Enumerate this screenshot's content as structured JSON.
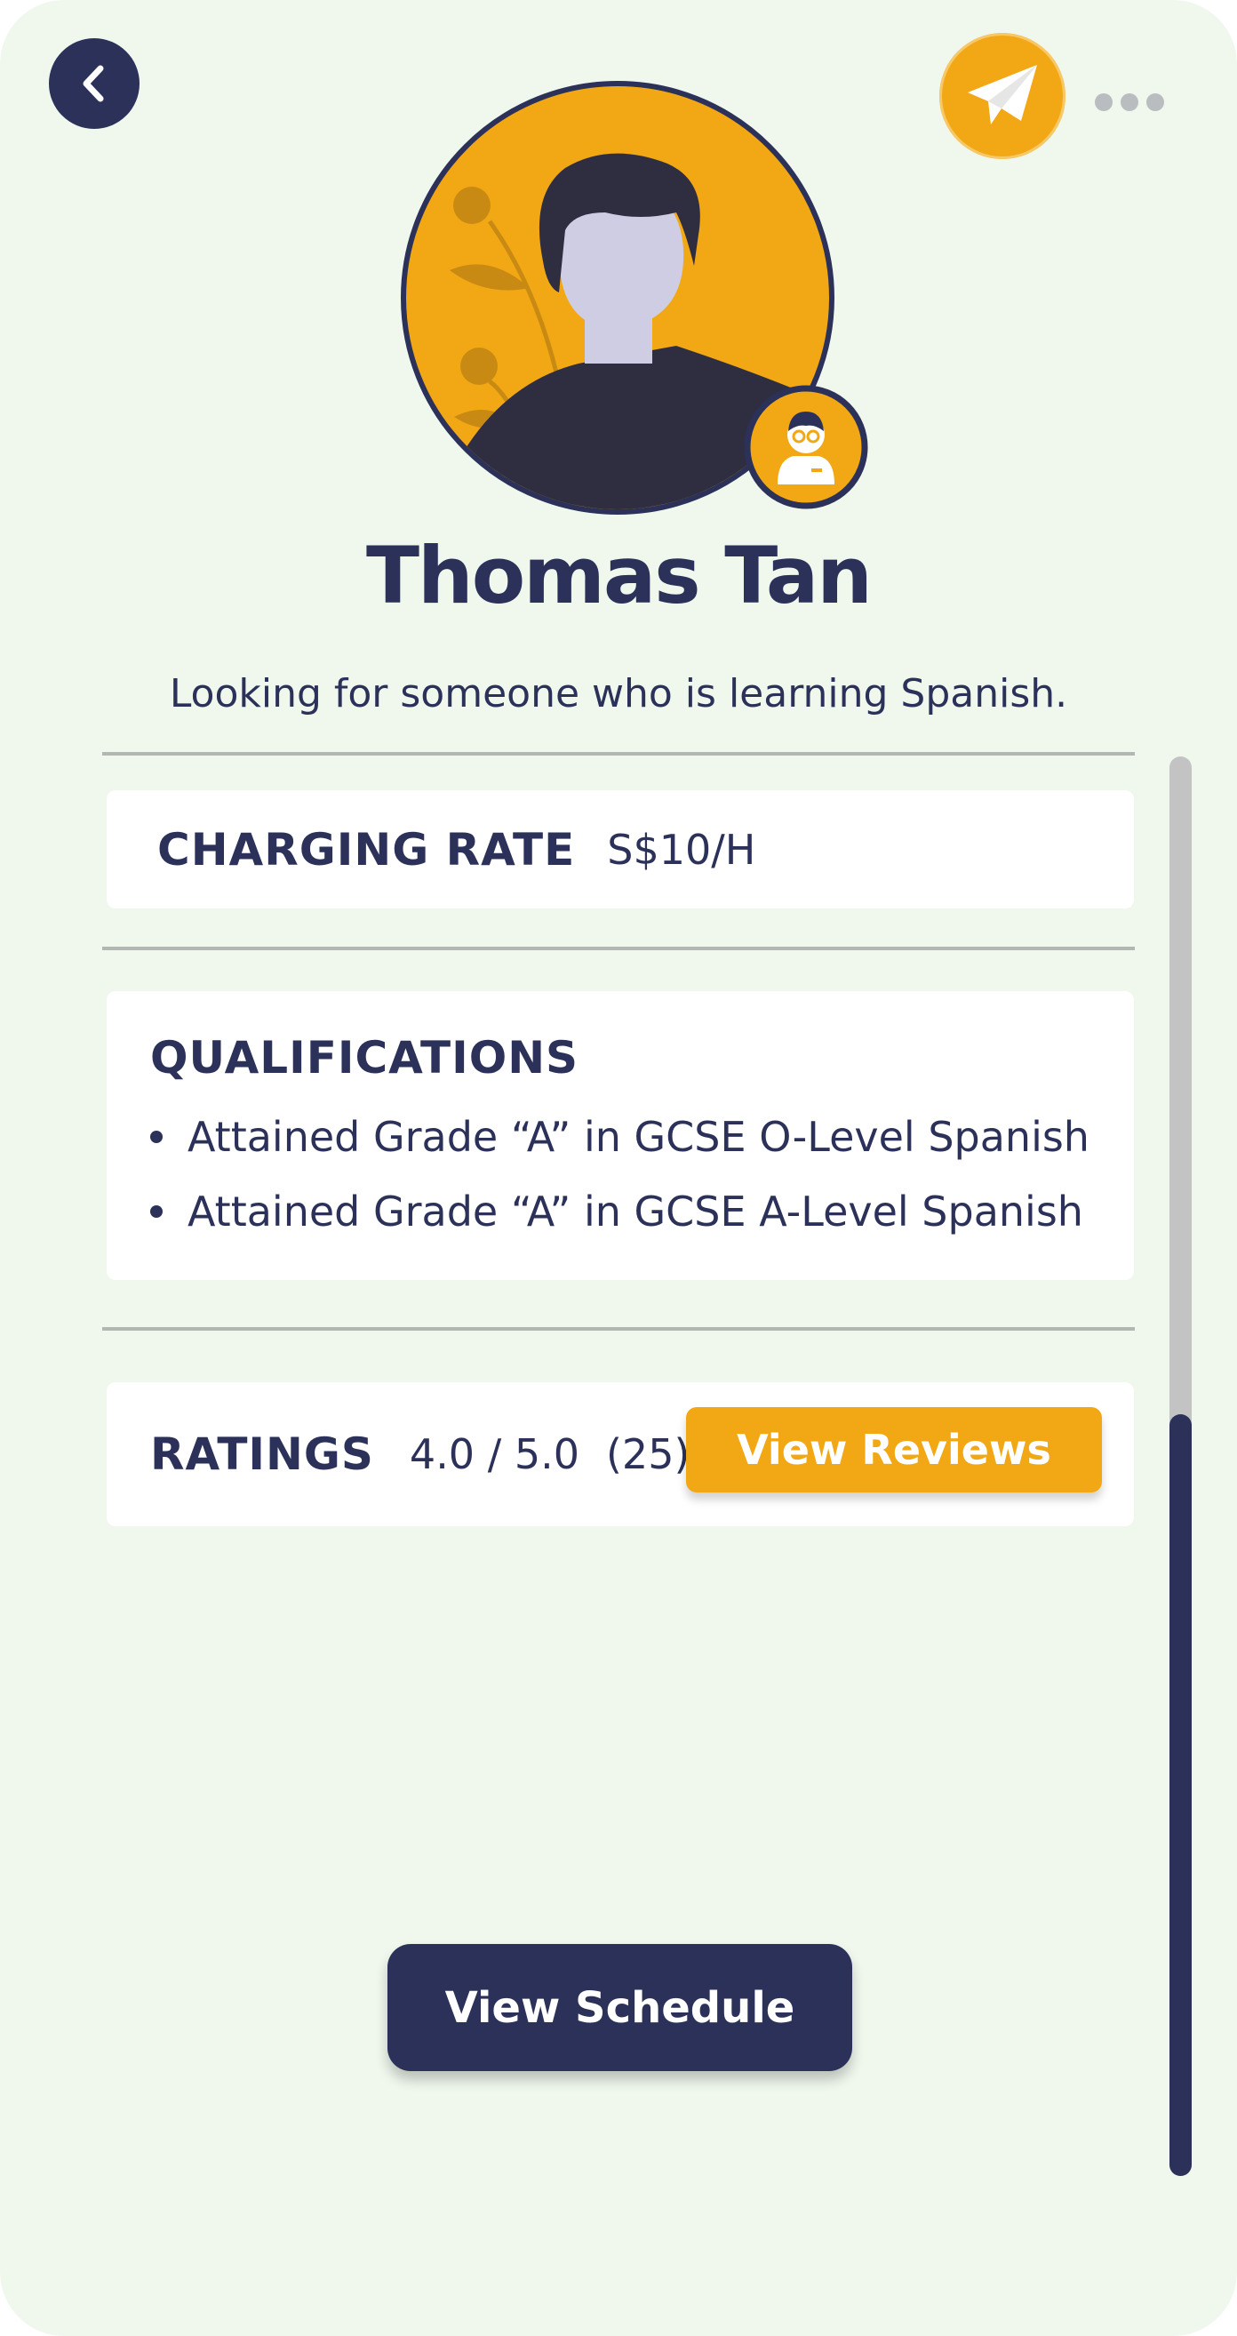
{
  "header": {
    "back_icon": "chevron-left-icon",
    "send_icon": "paper-plane-icon",
    "more_icon": "more-horizontal-icon"
  },
  "profile": {
    "name": "Thomas Tan",
    "bio": "Looking for someone who is learning Spanish.",
    "role_badge_icon": "tutor-icon"
  },
  "charging_rate": {
    "label": "CHARGING RATE",
    "value": "S$10/H"
  },
  "qualifications": {
    "title": "QUALIFICATIONS",
    "items": [
      "Attained Grade “A” in GCSE O-Level Spanish",
      "Attained Grade “A” in GCSE A-Level Spanish"
    ]
  },
  "ratings": {
    "label": "RATINGS",
    "score": "4.0 / 5.0",
    "count": "(25)",
    "view_reviews_label": "View Reviews"
  },
  "actions": {
    "view_schedule_label": "View Schedule"
  },
  "colors": {
    "primary": "#2b3159",
    "accent": "#f2a814",
    "background": "#f0f8ee",
    "card": "#ffffff",
    "divider": "#b2b7b4"
  }
}
